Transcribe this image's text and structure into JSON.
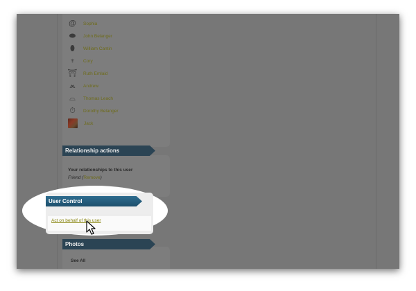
{
  "friends": [
    {
      "name": "Sophia",
      "icon": "spiral-icon",
      "glyph": "@"
    },
    {
      "name": "John Belanger",
      "icon": "disc-icon",
      "glyph": "⬬"
    },
    {
      "name": "William Cantin",
      "icon": "football-icon",
      "glyph": "⬮"
    },
    {
      "name": "Cory",
      "icon": "trophy-icon",
      "glyph": "♆"
    },
    {
      "name": "Ruth Emlaid",
      "icon": "crane-icon",
      "glyph": "⛩"
    },
    {
      "name": "Andrew",
      "icon": "campfire-icon",
      "glyph": "⩕"
    },
    {
      "name": "Thomas Leach",
      "icon": "hat-icon",
      "glyph": "⌓"
    },
    {
      "name": "Dorothy Belanger",
      "icon": "stopwatch-icon",
      "glyph": "⏱"
    },
    {
      "name": "Jack",
      "icon": "avatar-photo",
      "glyph": ""
    }
  ],
  "relationship": {
    "title": "Relationship actions",
    "heading": "Your relationships to this user",
    "status": "Friend",
    "remove_label": "Remove"
  },
  "user_control": {
    "title": "User Control",
    "act_link": "Act on behalf of this user"
  },
  "photos": {
    "title": "Photos",
    "see_all": "See All"
  },
  "colors": {
    "ribbon_active": "#2f6d8f",
    "link": "#8a8712",
    "overlay": "#777777"
  }
}
